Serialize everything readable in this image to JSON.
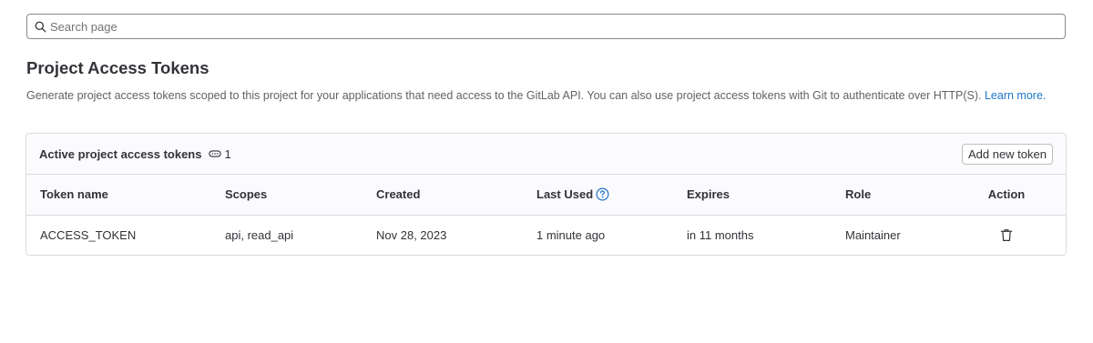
{
  "search": {
    "placeholder": "Search page"
  },
  "section": {
    "title": "Project Access Tokens",
    "description": "Generate project access tokens scoped to this project for your applications that need access to the GitLab API. You can also use project access tokens with Git to authenticate over HTTP(S).",
    "learn_more": "Learn more."
  },
  "card": {
    "title": "Active project access tokens",
    "count": "1",
    "add_button": "Add new token"
  },
  "table": {
    "columns": [
      "Token name",
      "Scopes",
      "Created",
      "Last Used",
      "Expires",
      "Role",
      "Action"
    ],
    "rows": [
      {
        "name": "ACCESS_TOKEN",
        "scopes": "api, read_api",
        "created": "Nov 28, 2023",
        "last_used": "1 minute ago",
        "expires": "in 11 months",
        "role": "Maintainer"
      }
    ]
  },
  "colors": {
    "link": "#1f75cb",
    "text": "#333238",
    "muted": "#626168",
    "border": "#dcdcde"
  }
}
